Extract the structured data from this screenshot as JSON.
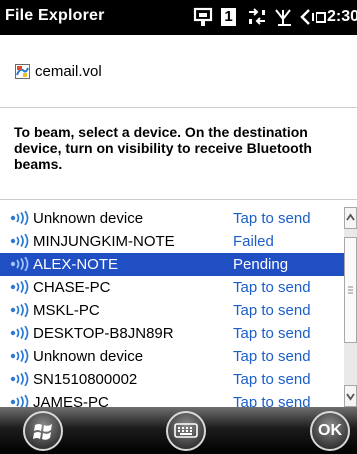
{
  "status_bar": {
    "app_title": "File Explorer",
    "notification_count": "1",
    "time": "2:30",
    "icons": [
      "app-switch-icon",
      "connectivity-icon",
      "signal-icon",
      "volume-icon",
      "battery-icon"
    ]
  },
  "file": {
    "icon": "volume-file-icon",
    "name": "cemail.vol"
  },
  "instructions": "To beam, select a device. On the destination device, turn on visibility to receive Bluetooth beams.",
  "devices": [
    {
      "name": "Unknown device",
      "status": "Tap to send",
      "selected": false
    },
    {
      "name": "MINJUNGKIM-NOTE",
      "status": "Failed",
      "selected": false
    },
    {
      "name": "ALEX-NOTE",
      "status": "Pending",
      "selected": true
    },
    {
      "name": "CHASE-PC",
      "status": "Tap to send",
      "selected": false
    },
    {
      "name": "MSKL-PC",
      "status": "Tap to send",
      "selected": false
    },
    {
      "name": "DESKTOP-B8JN89R",
      "status": "Tap to send",
      "selected": false
    },
    {
      "name": "Unknown device",
      "status": "Tap to send",
      "selected": false
    },
    {
      "name": "SN1510800002",
      "status": "Tap to send",
      "selected": false
    },
    {
      "name": "JAMES-PC",
      "status": "Tap to send",
      "selected": false
    }
  ],
  "softkeys": {
    "start_icon": "windows-logo-icon",
    "keyboard_icon": "keyboard-icon",
    "ok_label": "OK"
  },
  "colors": {
    "selection": "#1f4fc2",
    "status_link": "#1b5fc9",
    "title_bar": "#000000"
  }
}
